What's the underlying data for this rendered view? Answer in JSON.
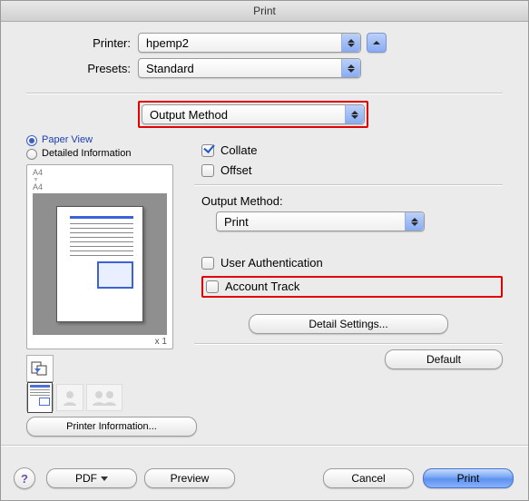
{
  "window": {
    "title": "Print"
  },
  "top": {
    "printer_label": "Printer:",
    "printer_value": "hpemp2",
    "presets_label": "Presets:",
    "presets_value": "Standard",
    "panel_value": "Output Method"
  },
  "left": {
    "paper_view": "Paper View",
    "detailed_info": "Detailed Information",
    "size_top": "A4",
    "size_bottom": "A4",
    "copies": "x 1",
    "printer_info_btn": "Printer Information..."
  },
  "right": {
    "collate": "Collate",
    "offset": "Offset",
    "output_method_label": "Output Method:",
    "output_method_value": "Print",
    "user_auth": "User Authentication",
    "account_track": "Account Track",
    "detail_settings": "Detail Settings...",
    "default": "Default"
  },
  "bottom": {
    "help": "?",
    "pdf": "PDF",
    "preview": "Preview",
    "cancel": "Cancel",
    "print": "Print"
  }
}
